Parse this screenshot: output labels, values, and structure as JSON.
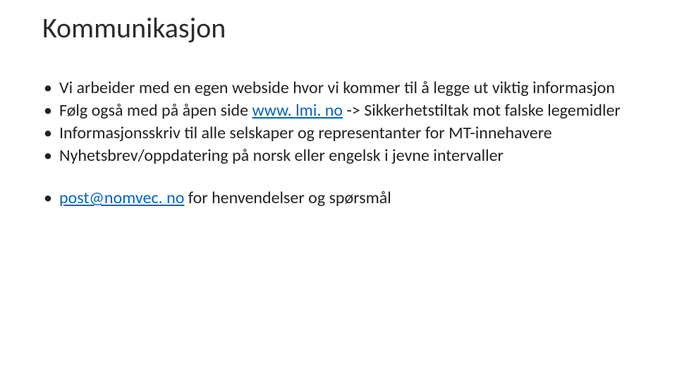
{
  "title": "Kommunikasjon",
  "bullets": {
    "b1": "Vi arbeider med en egen webside hvor vi kommer til å legge ut viktig informasjon",
    "b2_pre": "Følg også med på åpen side ",
    "b2_link": "www. lmi. no",
    "b2_post": " -> Sikkerhetstiltak mot falske legemidler",
    "b3": "Informasjonsskriv til alle selskaper og representanter for MT-innehavere",
    "b4": "Nyhetsbrev/oppdatering på norsk eller engelsk i jevne intervaller",
    "b5_link": "post@nomvec. no",
    "b5_post": " for henvendelser og spørsmål"
  }
}
